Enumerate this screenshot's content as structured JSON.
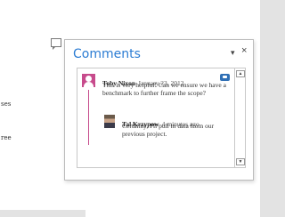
{
  "document": {
    "fragments": [
      "ses",
      "ree"
    ]
  },
  "pane": {
    "title": "Comments",
    "dropdown_glyph": "▾",
    "close_glyph": "×"
  },
  "comments": [
    {
      "author": "Toby Nixon",
      "date": "January 23, 2012",
      "text": "This is very helpful! Can we ensure we have a benchmark to further frame the scope?",
      "avatar": "person-silhouette-icon",
      "avatar_color": "#c74b8c",
      "replies": [
        {
          "author": "Tal Krzypow",
          "date": "4 minutes ago",
          "text": "Certainly, I'll pull in data from our previous project.",
          "avatar": "user-photo"
        }
      ]
    }
  ],
  "colors": {
    "accent": "#2b7cd3",
    "thread": "#c74b8c"
  }
}
